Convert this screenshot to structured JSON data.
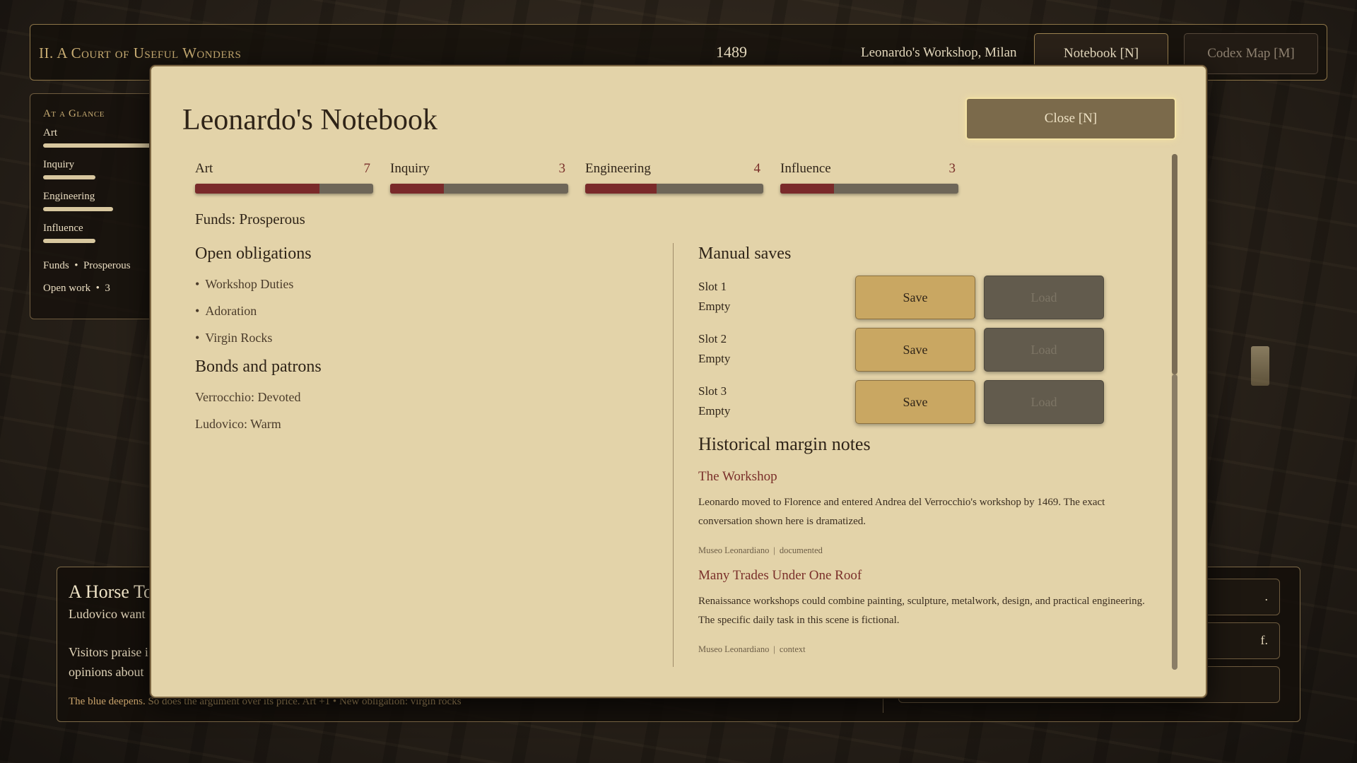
{
  "topbar": {
    "chapter": "II. A Court of Useful Wonders",
    "year": "1489",
    "location": "Leonardo's Workshop, Milan",
    "notebook_label": "Notebook  [N]",
    "codex_label": "Codex Map  [M]"
  },
  "glance": {
    "title": "At a Glance",
    "stats": [
      {
        "label": "Art",
        "value": 7
      },
      {
        "label": "Inquiry",
        "value": 3
      },
      {
        "label": "Engineering",
        "value": 4
      },
      {
        "label": "Influence",
        "value": 3
      }
    ],
    "funds_label": "Funds",
    "funds_value": "Prosperous",
    "openwork_label": "Open work",
    "openwork_value": "3"
  },
  "scene": {
    "title": "A Horse To",
    "subtitle": "Ludovico want",
    "body": "Visitors praise i opinions about",
    "footer_highlight": "The blue deepens.",
    "footer_rest": " So does the argument over its price.   Art +1  •  New obligation: virgin rocks",
    "choices": [
      ".",
      "f.",
      ""
    ]
  },
  "notebook": {
    "title": "Leonardo's Notebook",
    "close_label": "Close  [N]",
    "stats": [
      {
        "label": "Art",
        "value": 7,
        "fraction": 0.7
      },
      {
        "label": "Inquiry",
        "value": 3,
        "fraction": 0.3
      },
      {
        "label": "Engineering",
        "value": 4,
        "fraction": 0.4
      },
      {
        "label": "Influence",
        "value": 3,
        "fraction": 0.3
      }
    ],
    "funds": "Funds: Prosperous",
    "obligations_heading": "Open obligations",
    "obligations": [
      "Workshop Duties",
      "Adoration",
      "Virgin Rocks"
    ],
    "bonds_heading": "Bonds and patrons",
    "bonds": [
      "Verrocchio: Devoted",
      "Ludovico: Warm"
    ],
    "saves_heading": "Manual saves",
    "slots": [
      {
        "name": "Slot 1",
        "state": "Empty",
        "save": "Save",
        "load": "Load"
      },
      {
        "name": "Slot 2",
        "state": "Empty",
        "save": "Save",
        "load": "Load"
      },
      {
        "name": "Slot 3",
        "state": "Empty",
        "save": "Save",
        "load": "Load"
      }
    ],
    "notes_heading": "Historical margin notes",
    "notes": [
      {
        "title": "The Workshop",
        "body": "Leonardo moved to Florence and entered Andrea del Verrocchio's workshop by 1469. The exact conversation shown here is dramatized.",
        "source": "Museo Leonardiano",
        "tag": "documented"
      },
      {
        "title": "Many Trades Under One Roof",
        "body": "Renaissance workshops could combine painting, sculpture, metalwork, design, and practical engineering. The specific daily task in this scene is fictional.",
        "source": "Museo Leonardiano",
        "tag": "context"
      }
    ]
  },
  "colors": {
    "parchment": "#e3d3a9",
    "accent_red": "#7a2a2a",
    "gold": "#c9a762"
  }
}
